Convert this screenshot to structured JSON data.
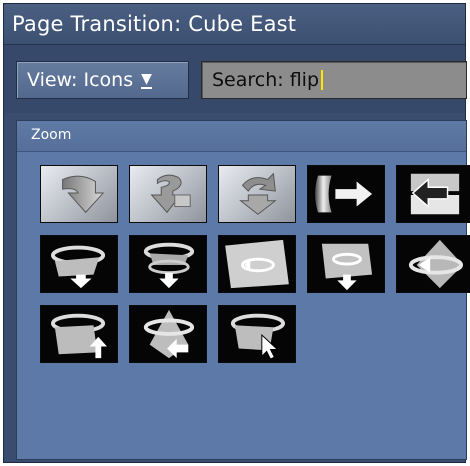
{
  "window": {
    "title": "Page Transition: Cube East"
  },
  "toolbar": {
    "view_label": "View: Icons",
    "view_arrow": "▼",
    "search_value": "Search: flip"
  },
  "panel": {
    "title": "Zoom"
  },
  "colors": {
    "title_bar": "#3c5072",
    "panel_bg": "#5c79a7",
    "search_bg": "#8c8c8c",
    "caret": "#ffe600"
  },
  "transitions": [
    {
      "icon": "curved-arrow-down-icon"
    },
    {
      "icon": "question-arrow-down-icon"
    },
    {
      "icon": "spin-arrow-icon"
    },
    {
      "icon": "flip-right-arrow-icon"
    },
    {
      "icon": "flip-left-arrow-icon"
    },
    {
      "icon": "rotate-down-icon"
    },
    {
      "icon": "rotate-stack-down-icon"
    },
    {
      "icon": "rotate-box-icon"
    },
    {
      "icon": "rotate-box-down-icon"
    },
    {
      "icon": "rotate-pyramid-icon"
    },
    {
      "icon": "rotate-cube-up-icon"
    },
    {
      "icon": "rotate-pyramid-left-icon"
    },
    {
      "icon": "rotate-cursor-icon"
    }
  ]
}
